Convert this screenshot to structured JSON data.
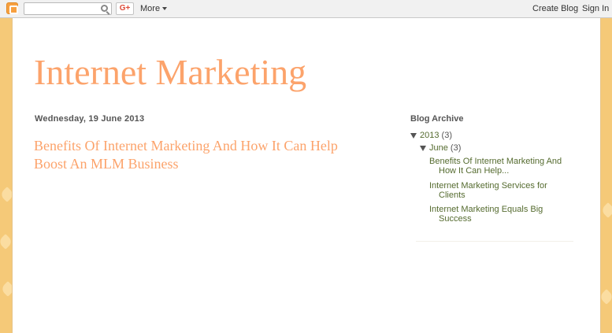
{
  "navbar": {
    "more_label": "More",
    "create_blog_label": "Create Blog",
    "sign_in_label": "Sign In",
    "gplus_label": "G+",
    "search_placeholder": ""
  },
  "blog": {
    "title": "Internet Marketing"
  },
  "post": {
    "date": "Wednesday, 19 June 2013",
    "title": "Benefits Of Internet Marketing And How It Can Help Boost An MLM Business"
  },
  "sidebar": {
    "archive_title": "Blog Archive",
    "year": {
      "label": "2013",
      "count": "(3)"
    },
    "month": {
      "label": "June",
      "count": "(3)"
    },
    "posts": [
      "Benefits Of Internet Marketing And How It Can Help...",
      "Internet Marketing Services for Clients",
      "Internet Marketing Equals Big Success"
    ]
  },
  "colors": {
    "title": "#fca36b",
    "link": "#556b2f",
    "background": "#f5c978"
  }
}
